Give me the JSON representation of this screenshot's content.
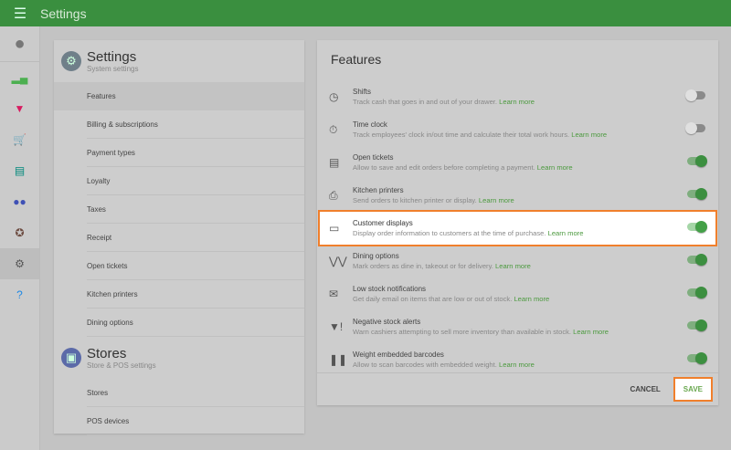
{
  "topbar": {
    "title": "Settings",
    "menu_icon": "hamburger-icon"
  },
  "rail": {
    "items": [
      {
        "icon": "account-icon",
        "color": "#777"
      },
      {
        "icon": "bar-chart-icon",
        "color": "#4caf50"
      },
      {
        "icon": "basket-icon",
        "color": "#d81b60"
      },
      {
        "icon": "cart-icon",
        "color": "#1e88e5"
      },
      {
        "icon": "customer-card-icon",
        "color": "#00897b"
      },
      {
        "icon": "employees-icon",
        "color": "#3f51b5"
      },
      {
        "icon": "puzzle-icon",
        "color": "#6d4c41"
      },
      {
        "icon": "gear-icon",
        "color": "#555",
        "active": true
      },
      {
        "icon": "help-icon",
        "color": "#1e88e5"
      }
    ]
  },
  "left": {
    "settings": {
      "title": "Settings",
      "subtitle": "System settings",
      "items": [
        "Features",
        "Billing & subscriptions",
        "Payment types",
        "Loyalty",
        "Taxes",
        "Receipt",
        "Open tickets",
        "Kitchen printers",
        "Dining options"
      ]
    },
    "stores": {
      "title": "Stores",
      "subtitle": "Store & POS settings",
      "items": [
        "Stores",
        "POS devices"
      ]
    }
  },
  "features": {
    "title": "Features",
    "learn_more": "Learn more",
    "items": [
      {
        "name": "Shifts",
        "desc": "Track cash that goes in and out of your drawer.",
        "on": false,
        "icon": "clock-icon"
      },
      {
        "name": "Time clock",
        "desc": "Track employees' clock in/out time and calculate their total work hours.",
        "on": false,
        "icon": "stopwatch-icon"
      },
      {
        "name": "Open tickets",
        "desc": "Allow to save and edit orders before completing a payment.",
        "on": true,
        "icon": "ticket-clock-icon"
      },
      {
        "name": "Kitchen printers",
        "desc": "Send orders to kitchen printer or display.",
        "on": true,
        "icon": "printer-icon"
      },
      {
        "name": "Customer displays",
        "desc": "Display order information to customers at the time of purchase.",
        "on": true,
        "icon": "display-icon",
        "highlight": true
      },
      {
        "name": "Dining options",
        "desc": "Mark orders as dine in, takeout or for delivery.",
        "on": true,
        "icon": "utensils-icon"
      },
      {
        "name": "Low stock notifications",
        "desc": "Get daily email on items that are low or out of stock.",
        "on": true,
        "icon": "mail-icon"
      },
      {
        "name": "Negative stock alerts",
        "desc": "Warn cashiers attempting to sell more inventory than available in stock.",
        "on": true,
        "icon": "basket-alert-icon"
      },
      {
        "name": "Weight embedded barcodes",
        "desc": "Allow to scan barcodes with embedded weight.",
        "on": true,
        "icon": "barcode-kg-icon"
      }
    ],
    "cancel": "CANCEL",
    "save": "SAVE"
  }
}
